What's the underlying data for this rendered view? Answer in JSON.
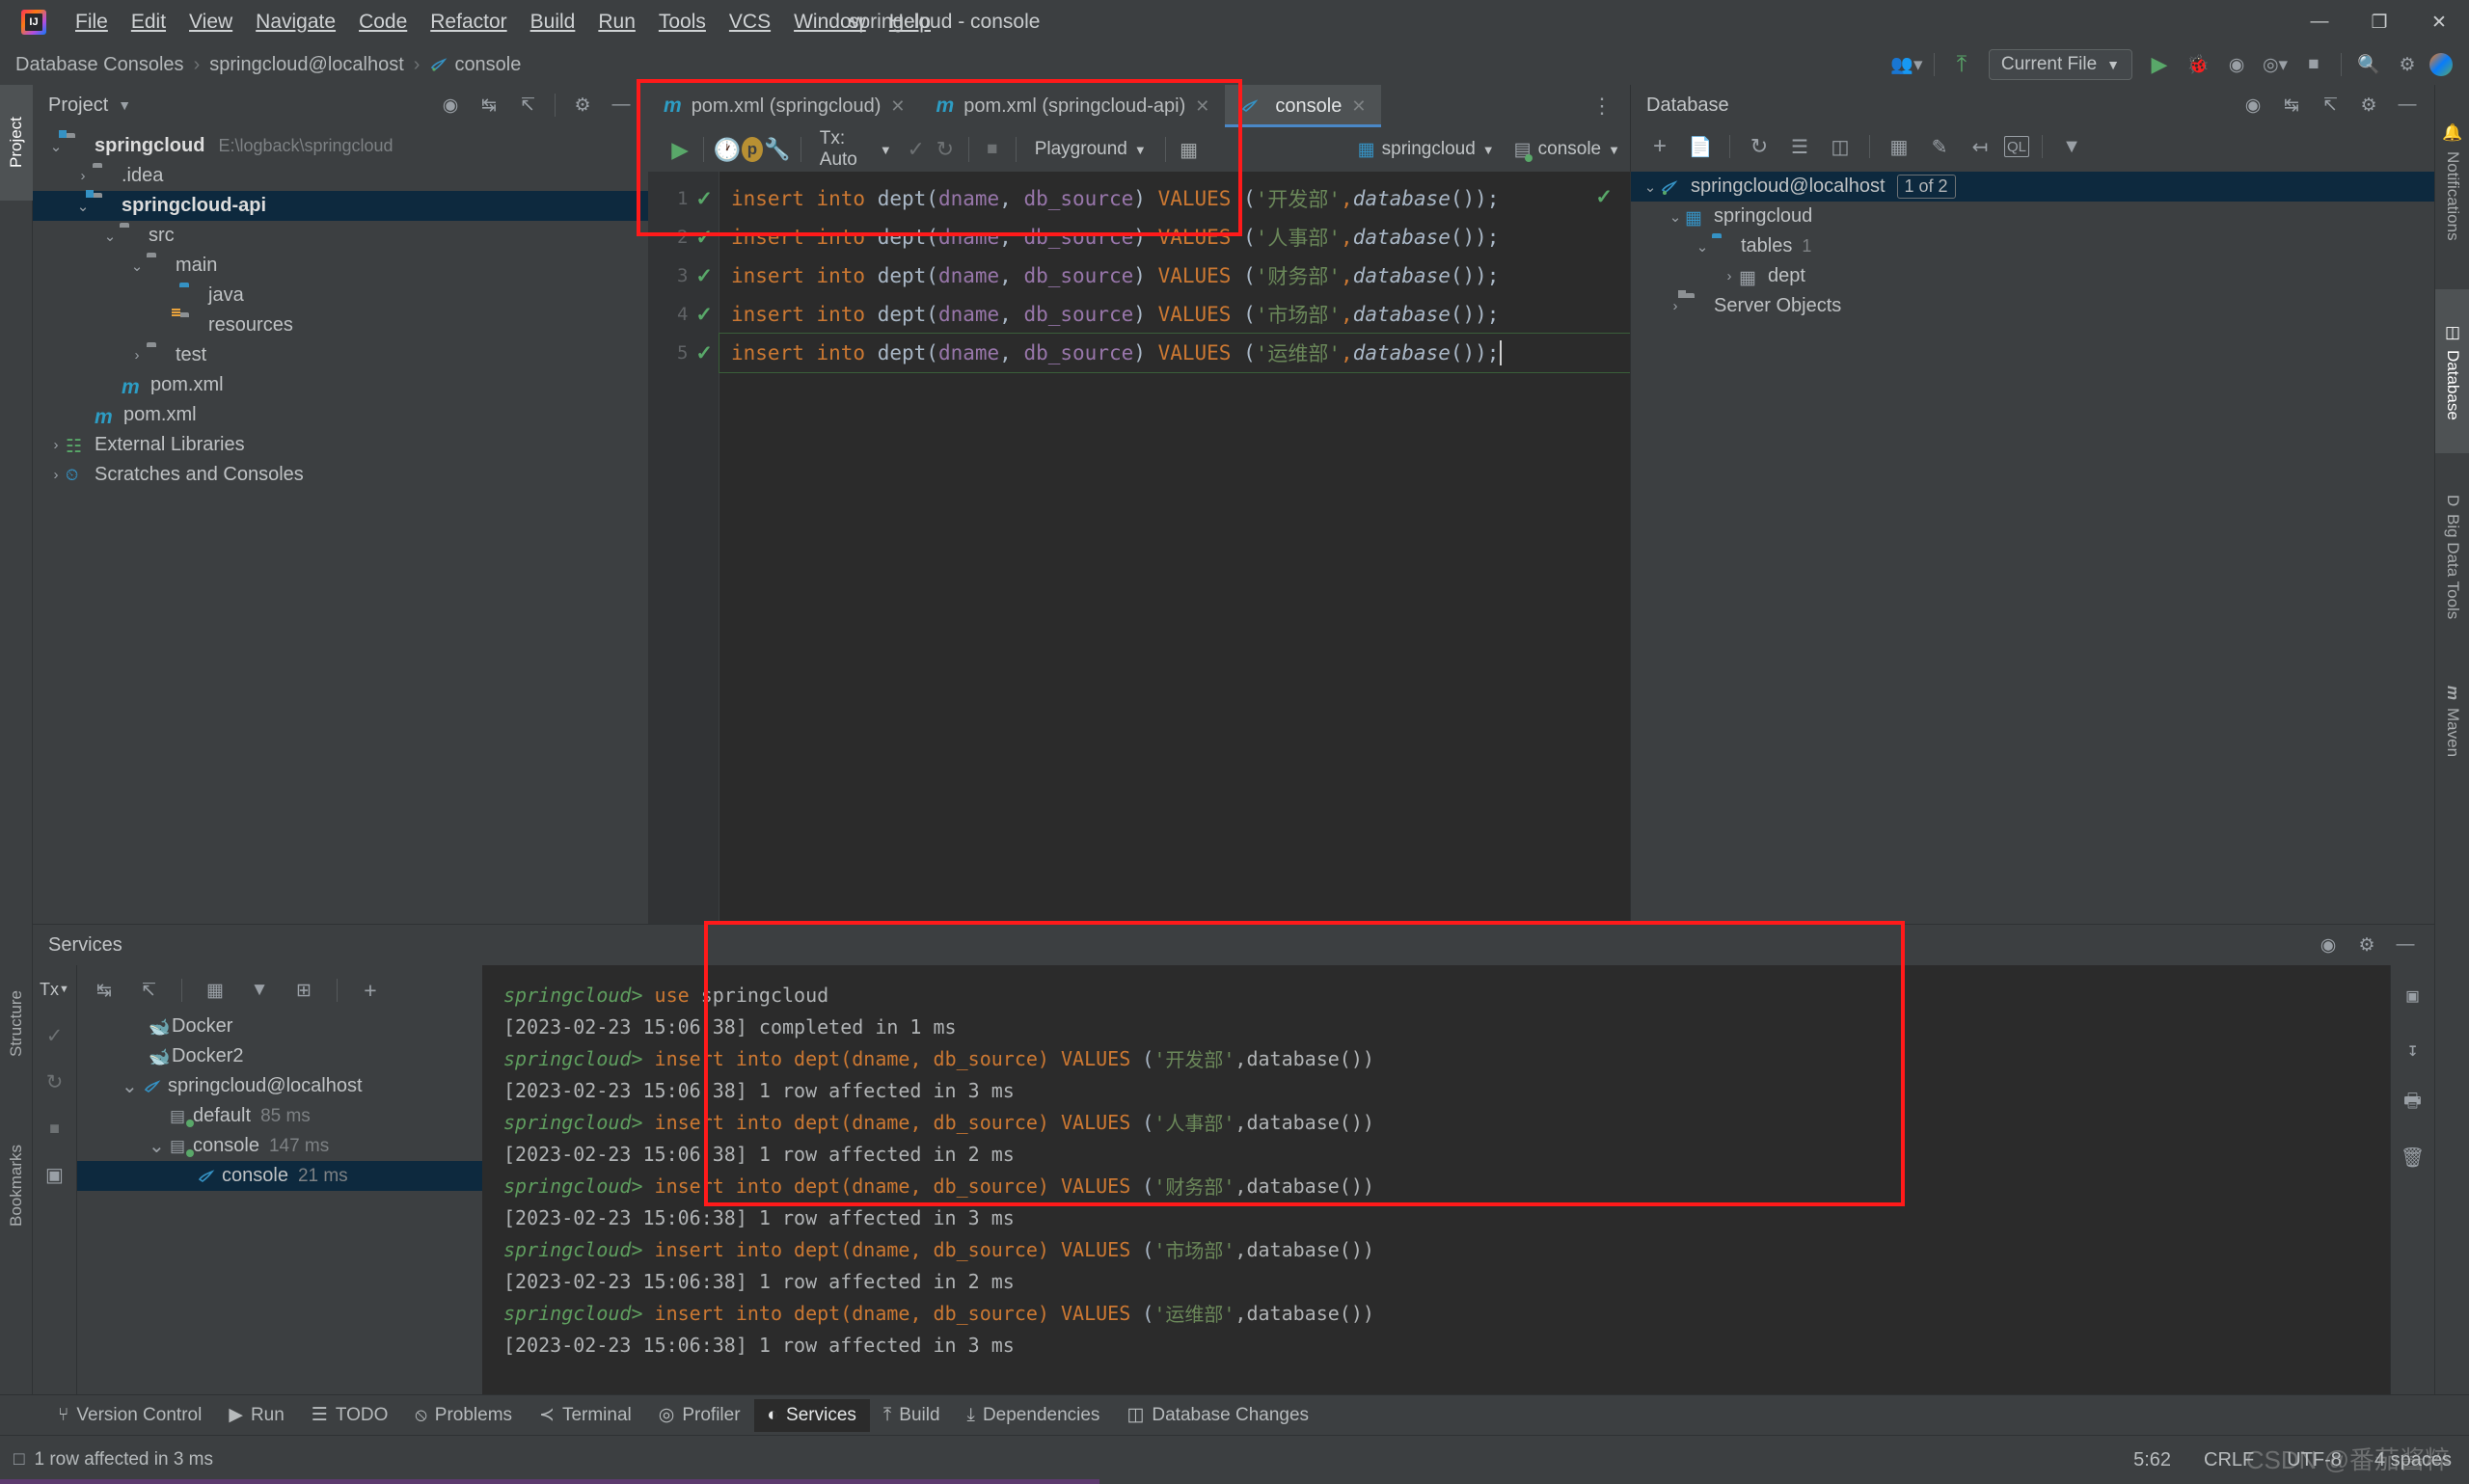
{
  "window": {
    "title": "springcloud - console",
    "minimize": "—",
    "maximize": "❐",
    "close": "✕"
  },
  "menubar": [
    {
      "label": "File"
    },
    {
      "label": "Edit"
    },
    {
      "label": "View"
    },
    {
      "label": "Navigate"
    },
    {
      "label": "Code"
    },
    {
      "label": "Refactor"
    },
    {
      "label": "Build"
    },
    {
      "label": "Run"
    },
    {
      "label": "Tools"
    },
    {
      "label": "VCS"
    },
    {
      "label": "Window"
    },
    {
      "label": "Help"
    }
  ],
  "breadcrumb": {
    "items": [
      "Database Consoles",
      "springcloud@localhost",
      "console"
    ],
    "separator": "›"
  },
  "nav_right": {
    "run_config": "Current File",
    "icons": [
      "user-group-icon",
      "build-hammer-icon",
      "run-icon",
      "debug-icon",
      "coverage-icon",
      "profile-icon",
      "stop-icon",
      "search-everywhere-icon",
      "settings-gear-icon",
      "updates-icon"
    ]
  },
  "left_strip": {
    "tabs": [
      {
        "label": "Project",
        "active": true
      },
      {
        "label": "Structure",
        "active": false
      },
      {
        "label": "Bookmarks",
        "active": false
      }
    ]
  },
  "right_strip": {
    "tabs": [
      {
        "label": "Notifications",
        "active": false
      },
      {
        "label": "Database",
        "active": true
      },
      {
        "label": "Big Data Tools",
        "active": false
      },
      {
        "label": "Maven",
        "active": false
      }
    ]
  },
  "project_panel": {
    "title": "Project",
    "tree": [
      {
        "indent": 0,
        "arrow": "⌄",
        "icon": "module-folder",
        "label": "springcloud",
        "sub": "E:\\logback\\springcloud",
        "bold": true,
        "selected": false
      },
      {
        "indent": 1,
        "arrow": "›",
        "icon": "folder",
        "label": ".idea",
        "sub": "",
        "bold": false,
        "selected": false
      },
      {
        "indent": 1,
        "arrow": "⌄",
        "icon": "module-folder",
        "label": "springcloud-api",
        "sub": "",
        "bold": true,
        "selected": true
      },
      {
        "indent": 2,
        "arrow": "⌄",
        "icon": "folder",
        "label": "src",
        "sub": "",
        "bold": false,
        "selected": false
      },
      {
        "indent": 3,
        "arrow": "⌄",
        "icon": "folder",
        "label": "main",
        "sub": "",
        "bold": false,
        "selected": false
      },
      {
        "indent": 4,
        "arrow": "",
        "icon": "source-folder",
        "label": "java",
        "sub": "",
        "bold": false,
        "selected": false
      },
      {
        "indent": 4,
        "arrow": "",
        "icon": "resource-folder",
        "label": "resources",
        "sub": "",
        "bold": false,
        "selected": false
      },
      {
        "indent": 3,
        "arrow": "›",
        "icon": "folder",
        "label": "test",
        "sub": "",
        "bold": false,
        "selected": false
      },
      {
        "indent": 3,
        "arrow": "",
        "icon": "maven",
        "label": "pom.xml",
        "sub": "",
        "bold": false,
        "selected": false
      },
      {
        "indent": 2,
        "arrow": "",
        "icon": "maven",
        "label": "pom.xml",
        "sub": "",
        "bold": false,
        "selected": false
      },
      {
        "indent": 0,
        "arrow": "›",
        "icon": "libraries",
        "label": "External Libraries",
        "sub": "",
        "bold": false,
        "selected": false
      },
      {
        "indent": 0,
        "arrow": "›",
        "icon": "scratches",
        "label": "Scratches and Consoles",
        "sub": "",
        "bold": false,
        "selected": false
      }
    ]
  },
  "editor": {
    "tabs": [
      {
        "label": "pom.xml (springcloud)",
        "icon": "maven-icon",
        "active": false
      },
      {
        "label": "pom.xml (springcloud-api)",
        "icon": "maven-icon",
        "active": false
      },
      {
        "label": "console",
        "icon": "mysql-dolphin-icon",
        "active": true
      }
    ],
    "toolbar": {
      "execute": "run-icon",
      "history": "history-clock-icon",
      "params": "parameters-icon",
      "wrench": "wrench-icon",
      "tx_mode": "Tx: Auto",
      "commit": "commit-checkmark-icon",
      "rollback": "rollback-icon",
      "stop": "stop-icon",
      "schema": "Playground",
      "grid": "table-grid-icon",
      "datasource": "springcloud",
      "session": "console"
    },
    "lines": [
      {
        "num": "1",
        "status": "ok",
        "text": "insert into dept(dname, db_source) VALUES ('开发部',database());"
      },
      {
        "num": "2",
        "status": "ok",
        "text": "insert into dept(dname, db_source) VALUES ('人事部',database());"
      },
      {
        "num": "3",
        "status": "ok",
        "text": "insert into dept(dname, db_source) VALUES ('财务部',database());"
      },
      {
        "num": "4",
        "status": "ok",
        "text": "insert into dept(dname, db_source) VALUES ('市场部',database());"
      },
      {
        "num": "5",
        "status": "ok",
        "text": "insert into dept(dname, db_source) VALUES ('运维部',database());"
      }
    ],
    "tokens": [
      {
        "kw": "insert into ",
        "tbl": "dept",
        "p1": "(",
        "c1": "dname",
        "p2": ", ",
        "c2": "db_source",
        "p3": ") ",
        "kw2": "VALUES ",
        "p4": "(",
        "s": "'开发部'",
        "p5": ",",
        "f": "database",
        "p6": "());"
      },
      {
        "kw": "insert into ",
        "tbl": "dept",
        "p1": "(",
        "c1": "dname",
        "p2": ", ",
        "c2": "db_source",
        "p3": ") ",
        "kw2": "VALUES ",
        "p4": "(",
        "s": "'人事部'",
        "p5": ",",
        "f": "database",
        "p6": "());"
      },
      {
        "kw": "insert into ",
        "tbl": "dept",
        "p1": "(",
        "c1": "dname",
        "p2": ", ",
        "c2": "db_source",
        "p3": ") ",
        "kw2": "VALUES ",
        "p4": "(",
        "s": "'财务部'",
        "p5": ",",
        "f": "database",
        "p6": "());"
      },
      {
        "kw": "insert into ",
        "tbl": "dept",
        "p1": "(",
        "c1": "dname",
        "p2": ", ",
        "c2": "db_source",
        "p3": ") ",
        "kw2": "VALUES ",
        "p4": "(",
        "s": "'市场部'",
        "p5": ",",
        "f": "database",
        "p6": "());"
      },
      {
        "kw": "insert into ",
        "tbl": "dept",
        "p1": "(",
        "c1": "dname",
        "p2": ", ",
        "c2": "db_source",
        "p3": ") ",
        "kw2": "VALUES ",
        "p4": "(",
        "s": "'运维部'",
        "p5": ",",
        "f": "database",
        "p6": "());"
      }
    ]
  },
  "database_panel": {
    "title": "Database",
    "toolbar_icons": [
      "add-plus-icon",
      "copy-icon",
      "refresh-icon",
      "sql-script-icon",
      "db-drop-icon",
      "table-editor-icon",
      "edit-pencil-icon",
      "jump-to-icon",
      "query-console-icon",
      "filter-icon"
    ],
    "tree": [
      {
        "indent": 0,
        "arrow": "⌄",
        "icon": "mysql-dolphin",
        "label": "springcloud@localhost",
        "badge": "1 of 2",
        "count": "",
        "selected": true
      },
      {
        "indent": 1,
        "arrow": "⌄",
        "icon": "schema",
        "label": "springcloud",
        "badge": "",
        "count": "",
        "selected": false
      },
      {
        "indent": 2,
        "arrow": "⌄",
        "icon": "folder-blue",
        "label": "tables",
        "badge": "",
        "count": "1",
        "selected": false
      },
      {
        "indent": 3,
        "arrow": "›",
        "icon": "table",
        "label": "dept",
        "badge": "",
        "count": "",
        "selected": false
      },
      {
        "indent": 1,
        "arrow": "›",
        "icon": "server-objects",
        "label": "Server Objects",
        "badge": "",
        "count": "",
        "selected": false
      }
    ]
  },
  "services_panel": {
    "title": "Services",
    "toolbar": {
      "tx": "Tx",
      "icons": [
        "expand-all-icon",
        "collapse-all-icon",
        "group-icon",
        "filter-icon",
        "new-tab-icon",
        "add-plus-icon"
      ]
    },
    "vbar_icons": [
      "commit-checkmark-icon",
      "rollback-icon",
      "stop-icon",
      "layout-icon"
    ],
    "tree": [
      {
        "indent": 1,
        "arrow": "",
        "icon": "docker",
        "label": "Docker",
        "ms": "",
        "selected": false
      },
      {
        "indent": 1,
        "arrow": "",
        "icon": "docker",
        "label": "Docker2",
        "ms": "",
        "selected": false
      },
      {
        "indent": 0,
        "arrow": "⌄",
        "icon": "mysql-dolphin",
        "label": "springcloud@localhost",
        "ms": "",
        "selected": false
      },
      {
        "indent": 1,
        "arrow": "",
        "icon": "session",
        "label": "default",
        "ms": "85 ms",
        "selected": false
      },
      {
        "indent": 1,
        "arrow": "⌄",
        "icon": "session",
        "label": "console",
        "ms": "147 ms",
        "selected": false
      },
      {
        "indent": 2,
        "arrow": "",
        "icon": "mysql-dolphin",
        "label": "console",
        "ms": "21 ms",
        "selected": true
      }
    ],
    "console_output": [
      {
        "type": "query",
        "prompt": "springcloud>",
        "kw": "use ",
        "rest": "springcloud"
      },
      {
        "type": "result",
        "text": "[2023-02-23 15:06:38] completed in 1 ms"
      },
      {
        "type": "sql",
        "prompt": "springcloud>",
        "value": "'开发部'"
      },
      {
        "type": "result",
        "text": "[2023-02-23 15:06:38] 1 row affected in 3 ms"
      },
      {
        "type": "sql",
        "prompt": "springcloud>",
        "value": "'人事部'"
      },
      {
        "type": "result",
        "text": "[2023-02-23 15:06:38] 1 row affected in 2 ms"
      },
      {
        "type": "sql",
        "prompt": "springcloud>",
        "value": "'财务部'"
      },
      {
        "type": "result",
        "text": "[2023-02-23 15:06:38] 1 row affected in 3 ms"
      },
      {
        "type": "sql",
        "prompt": "springcloud>",
        "value": "'市场部'"
      },
      {
        "type": "result",
        "text": "[2023-02-23 15:06:38] 1 row affected in 2 ms"
      },
      {
        "type": "sql",
        "prompt": "springcloud>",
        "value": "'运维部'"
      },
      {
        "type": "result",
        "text": "[2023-02-23 15:06:38] 1 row affected in 3 ms"
      }
    ],
    "sql_prefix": "insert into dept(dname, db_source) ",
    "sql_values_kw": "VALUES ",
    "sql_suffix": ",database())",
    "right_strip_icons": [
      "layout-icon",
      "export-icon",
      "print-icon",
      "delete-trash-icon"
    ]
  },
  "toolwindow_bar": [
    {
      "label": "Version Control",
      "icon": "branch-icon",
      "active": false
    },
    {
      "label": "Run",
      "icon": "run-icon",
      "active": false
    },
    {
      "label": "TODO",
      "icon": "todo-icon",
      "active": false
    },
    {
      "label": "Problems",
      "icon": "problems-icon",
      "active": false
    },
    {
      "label": "Terminal",
      "icon": "terminal-icon",
      "active": false
    },
    {
      "label": "Profiler",
      "icon": "profiler-icon",
      "active": false
    },
    {
      "label": "Services",
      "icon": "services-icon",
      "active": true
    },
    {
      "label": "Build",
      "icon": "build-icon",
      "active": false
    },
    {
      "label": "Dependencies",
      "icon": "dependencies-icon",
      "active": false
    },
    {
      "label": "Database Changes",
      "icon": "db-changes-icon",
      "active": false
    }
  ],
  "statusbar": {
    "message": "1 row affected in 3 ms",
    "caret": "5:62",
    "line_sep": "CRLF",
    "encoding": "UTF-8",
    "indent": "4 spaces",
    "watermark": "CSDN @番茄酱粹"
  },
  "colors": {
    "bg": "#3c3f41",
    "editor_bg": "#2b2b2b",
    "selection": "#0d293e",
    "accent_blue": "#4a88c7",
    "green_ok": "#59a869",
    "red_box": "#ff1a1a",
    "keyword": "#cc7832",
    "string": "#6a8759",
    "column": "#9876aa"
  }
}
